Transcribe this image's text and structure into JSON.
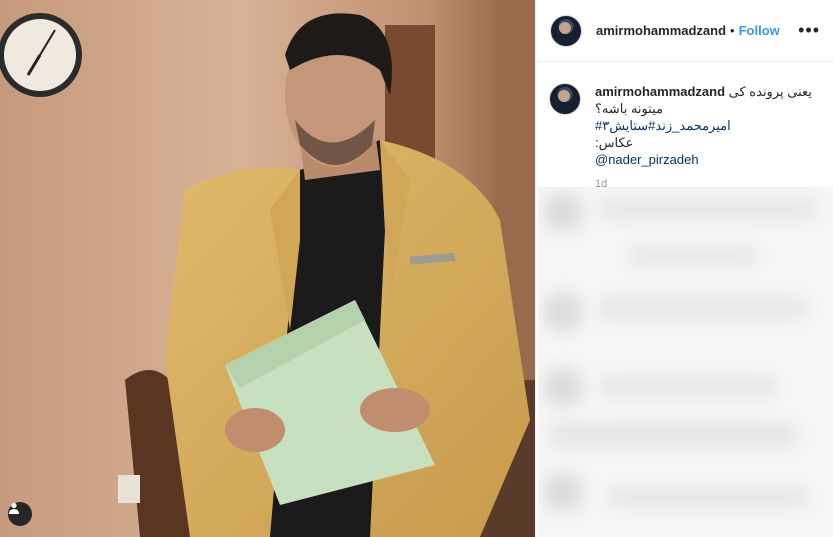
{
  "post": {
    "username": "amirmohammadzand",
    "separator": "•",
    "follow_label": "Follow",
    "more_icon": "•••",
    "caption": {
      "line1": "یعنی پرونده کی",
      "line2": "میتونه باشه؟",
      "hashtags": "امیرمحمد_زند#ستایش۳#",
      "photo_credit": "عکاس:",
      "mention": "@nader_pirzadeh"
    },
    "time_ago": "1d"
  },
  "colors": {
    "accent": "#3897f0",
    "link": "#003569",
    "text": "#262626",
    "muted": "#999999"
  },
  "icons": {
    "more": "more-options-icon",
    "tag": "user-tag-icon"
  }
}
